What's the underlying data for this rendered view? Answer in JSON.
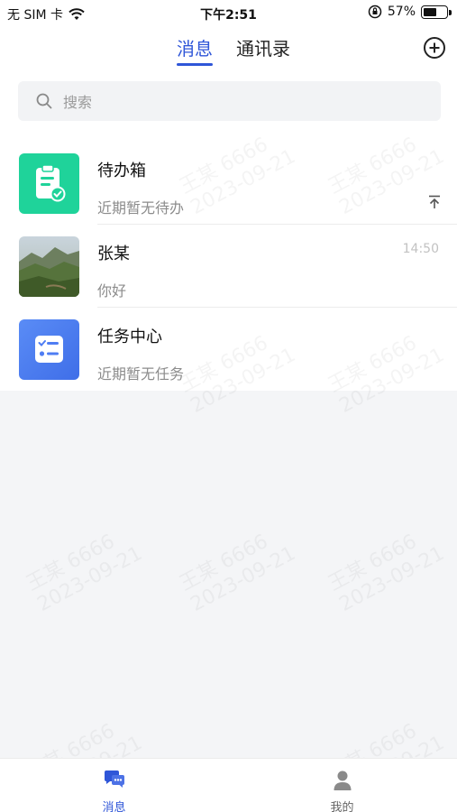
{
  "status_bar": {
    "carrier": "无 SIM 卡",
    "time": "下午2:51",
    "battery_percent_text": "57%",
    "battery_level": 0.57
  },
  "header": {
    "tabs": [
      {
        "label": "消息",
        "active": true
      },
      {
        "label": "通讯录",
        "active": false
      }
    ],
    "add_icon": "plus-circle-icon"
  },
  "search": {
    "placeholder": "搜索",
    "icon": "search-icon"
  },
  "conversations": [
    {
      "title": "待办箱",
      "subtitle": "近期暂无待办",
      "icon": "todo-clipboard-icon",
      "pinned": true,
      "time": ""
    },
    {
      "title": "张某",
      "subtitle": "你好",
      "icon": "landscape-avatar",
      "pinned": false,
      "time": "14:50"
    },
    {
      "title": "任务中心",
      "subtitle": "近期暂无任务",
      "icon": "task-list-icon",
      "pinned": false,
      "time": ""
    }
  ],
  "watermark": {
    "line1": "王某 6666",
    "line2": "2023-09-21"
  },
  "bottom_nav": [
    {
      "label": "消息",
      "icon": "chat-bubbles-icon",
      "active": true
    },
    {
      "label": "我的",
      "icon": "user-icon",
      "active": false
    }
  ],
  "colors": {
    "accent": "#2f56d8",
    "todo_green": "#1fd39a",
    "task_blue": "#4f7df3"
  }
}
